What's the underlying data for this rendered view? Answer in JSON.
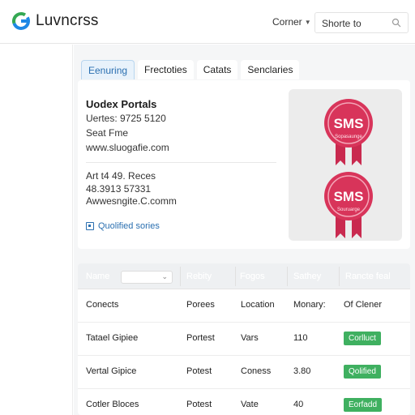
{
  "header": {
    "brand": "Luvncrss",
    "menu_label": "Corner",
    "search_text": "Shorte to"
  },
  "tabs": [
    {
      "label": "Eenuring",
      "active": true
    },
    {
      "label": "Frectoties",
      "active": false
    },
    {
      "label": "Catats",
      "active": false
    },
    {
      "label": "Senclaries",
      "active": false
    }
  ],
  "info": {
    "title": "Uodex Portals",
    "line1": "Uertes: 9725 5120",
    "line2": "Seat Fme",
    "line3": "www.sluogafie.com",
    "line4": "Art t4 49. Reces",
    "line5": "48.3913 57331",
    "line6": "Awwesngite.C.comm",
    "link_label": "Quolified sories"
  },
  "badges": [
    {
      "title": "SMS",
      "subtitle": "Sopasaunge",
      "color": "#d8345a"
    },
    {
      "title": "SMS",
      "subtitle": "Souruarge",
      "color": "#d8345a"
    }
  ],
  "table": {
    "headers": [
      "Name",
      "Rebity",
      "Fogos",
      "Sathey",
      "Rancte feal"
    ],
    "header_row": [
      "Conects",
      "Porees",
      "Location",
      "Monary:",
      "Of Clener"
    ],
    "rows": [
      {
        "name": "Tatael Gipiee",
        "col2": "Portest",
        "col3": "Vars",
        "col4": "110",
        "status": "Corlluct"
      },
      {
        "name": "Vertal Gipice",
        "col2": "Potest",
        "col3": "Coness",
        "col4": "3.80",
        "status": "Qolified"
      },
      {
        "name": "Cotler Bloces",
        "col2": "Potest",
        "col3": "Vate",
        "col4": "40",
        "status": "Eorfadd"
      }
    ],
    "status_color": "#3fb060"
  }
}
